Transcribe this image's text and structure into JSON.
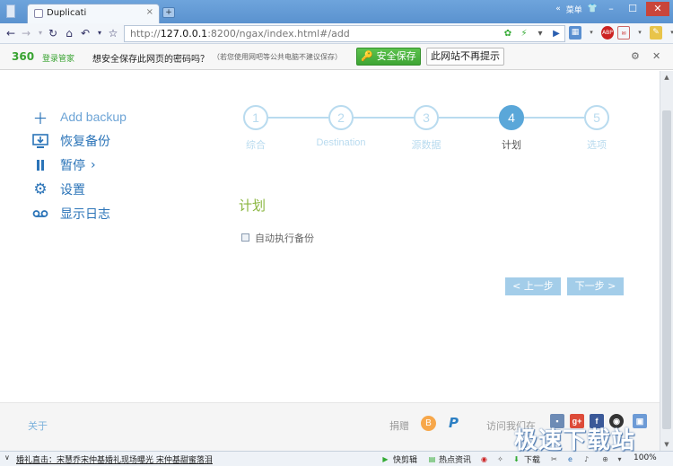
{
  "browser": {
    "tab_title": "Duplicati",
    "tab_close": "×",
    "new_tab": "+",
    "menu_label": "菜单",
    "url_prefix": "http://",
    "url_host": "127.0.0.1",
    "url_rest": ":8200/ngax/index.html#/add"
  },
  "password_bar": {
    "logo": "360",
    "logo_sub": "登录管家",
    "question": "想安全保存此网页的密码吗？",
    "note": "（若您使用网吧等公共电脑不建议保存）",
    "save_label": "安全保存",
    "never_label": "此网站不再提示"
  },
  "sidebar": {
    "items": [
      {
        "label": "Add backup",
        "icon": "plus-icon"
      },
      {
        "label": "恢复备份",
        "icon": "monitor-download-icon"
      },
      {
        "label": "暂停",
        "icon": "pause-icon"
      },
      {
        "label": "设置",
        "icon": "gear-icon"
      },
      {
        "label": "显示日志",
        "icon": "log-tape-icon"
      }
    ]
  },
  "stepper": {
    "steps": [
      {
        "number": "1",
        "label": "综合"
      },
      {
        "number": "2",
        "label": "Destination"
      },
      {
        "number": "3",
        "label": "源数据"
      },
      {
        "number": "4",
        "label": "计划"
      },
      {
        "number": "5",
        "label": "选项"
      }
    ],
    "active_step": 4
  },
  "schedule": {
    "title": "计划",
    "auto_run_label": "自动执行备份",
    "auto_run_checked": false,
    "prev_label": "< 上一步",
    "next_label": "下一步 >"
  },
  "footer": {
    "about": "关于",
    "donate": "捐赠",
    "bitcoin_symbol": "B",
    "paypal_symbol": "P",
    "visit": "访问我们在"
  },
  "statusbar": {
    "news_prefix": "婚礼直击：",
    "news_text": "宋慧乔宋仲基婚礼现场曝光 宋仲基甜蜜落泪",
    "kuaijian": "快剪辑",
    "hot_news": "热点资讯",
    "download": "下载",
    "zoom": "100%"
  },
  "watermark": "极速下载站",
  "colors": {
    "accent": "#2b74b8",
    "step_active": "#5aa7d9",
    "step_inactive": "#b9dbef",
    "section_title": "#8ab63f",
    "button_bg": "#a3cde9",
    "save_green": "#3ea534"
  }
}
